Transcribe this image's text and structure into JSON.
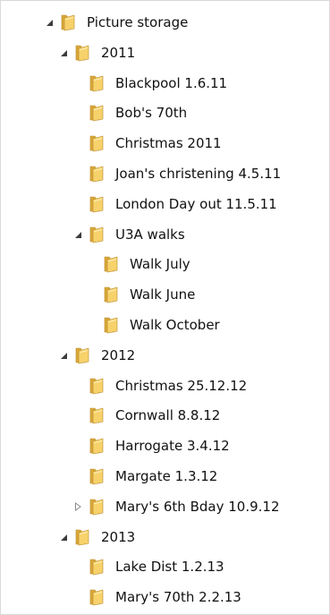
{
  "tree": [
    {
      "label": "Picture storage",
      "depth": 0,
      "state": "expanded"
    },
    {
      "label": "2011",
      "depth": 1,
      "state": "expanded"
    },
    {
      "label": "Blackpool 1.6.11",
      "depth": 2,
      "state": "leaf"
    },
    {
      "label": "Bob's 70th",
      "depth": 2,
      "state": "leaf"
    },
    {
      "label": "Christmas 2011",
      "depth": 2,
      "state": "leaf"
    },
    {
      "label": "Joan's christening 4.5.11",
      "depth": 2,
      "state": "leaf"
    },
    {
      "label": "London Day out 11.5.11",
      "depth": 2,
      "state": "leaf"
    },
    {
      "label": "U3A walks",
      "depth": 2,
      "state": "expanded"
    },
    {
      "label": "Walk July",
      "depth": 3,
      "state": "leaf"
    },
    {
      "label": "Walk June",
      "depth": 3,
      "state": "leaf"
    },
    {
      "label": "Walk October",
      "depth": 3,
      "state": "leaf"
    },
    {
      "label": "2012",
      "depth": 1,
      "state": "expanded"
    },
    {
      "label": "Christmas 25.12.12",
      "depth": 2,
      "state": "leaf"
    },
    {
      "label": "Cornwall  8.8.12",
      "depth": 2,
      "state": "leaf"
    },
    {
      "label": "Harrogate 3.4.12",
      "depth": 2,
      "state": "leaf"
    },
    {
      "label": "Margate 1.3.12",
      "depth": 2,
      "state": "leaf"
    },
    {
      "label": "Mary's 6th Bday 10.9.12",
      "depth": 2,
      "state": "collapsed"
    },
    {
      "label": "2013",
      "depth": 1,
      "state": "expanded"
    },
    {
      "label": "Lake Dist 1.2.13",
      "depth": 2,
      "state": "leaf"
    },
    {
      "label": "Mary's 70th 2.2.13",
      "depth": 2,
      "state": "leaf"
    }
  ],
  "icons": {
    "expanded": "triangle-down-icon",
    "collapsed": "triangle-right-icon",
    "folder": "folder-icon"
  },
  "colors": {
    "folder_back": "#d9a93a",
    "folder_front": "#f7d26b",
    "folder_edge": "#b9892a",
    "arrow_expanded": "#3c3c3c",
    "arrow_collapsed": "#8a8a8a"
  }
}
